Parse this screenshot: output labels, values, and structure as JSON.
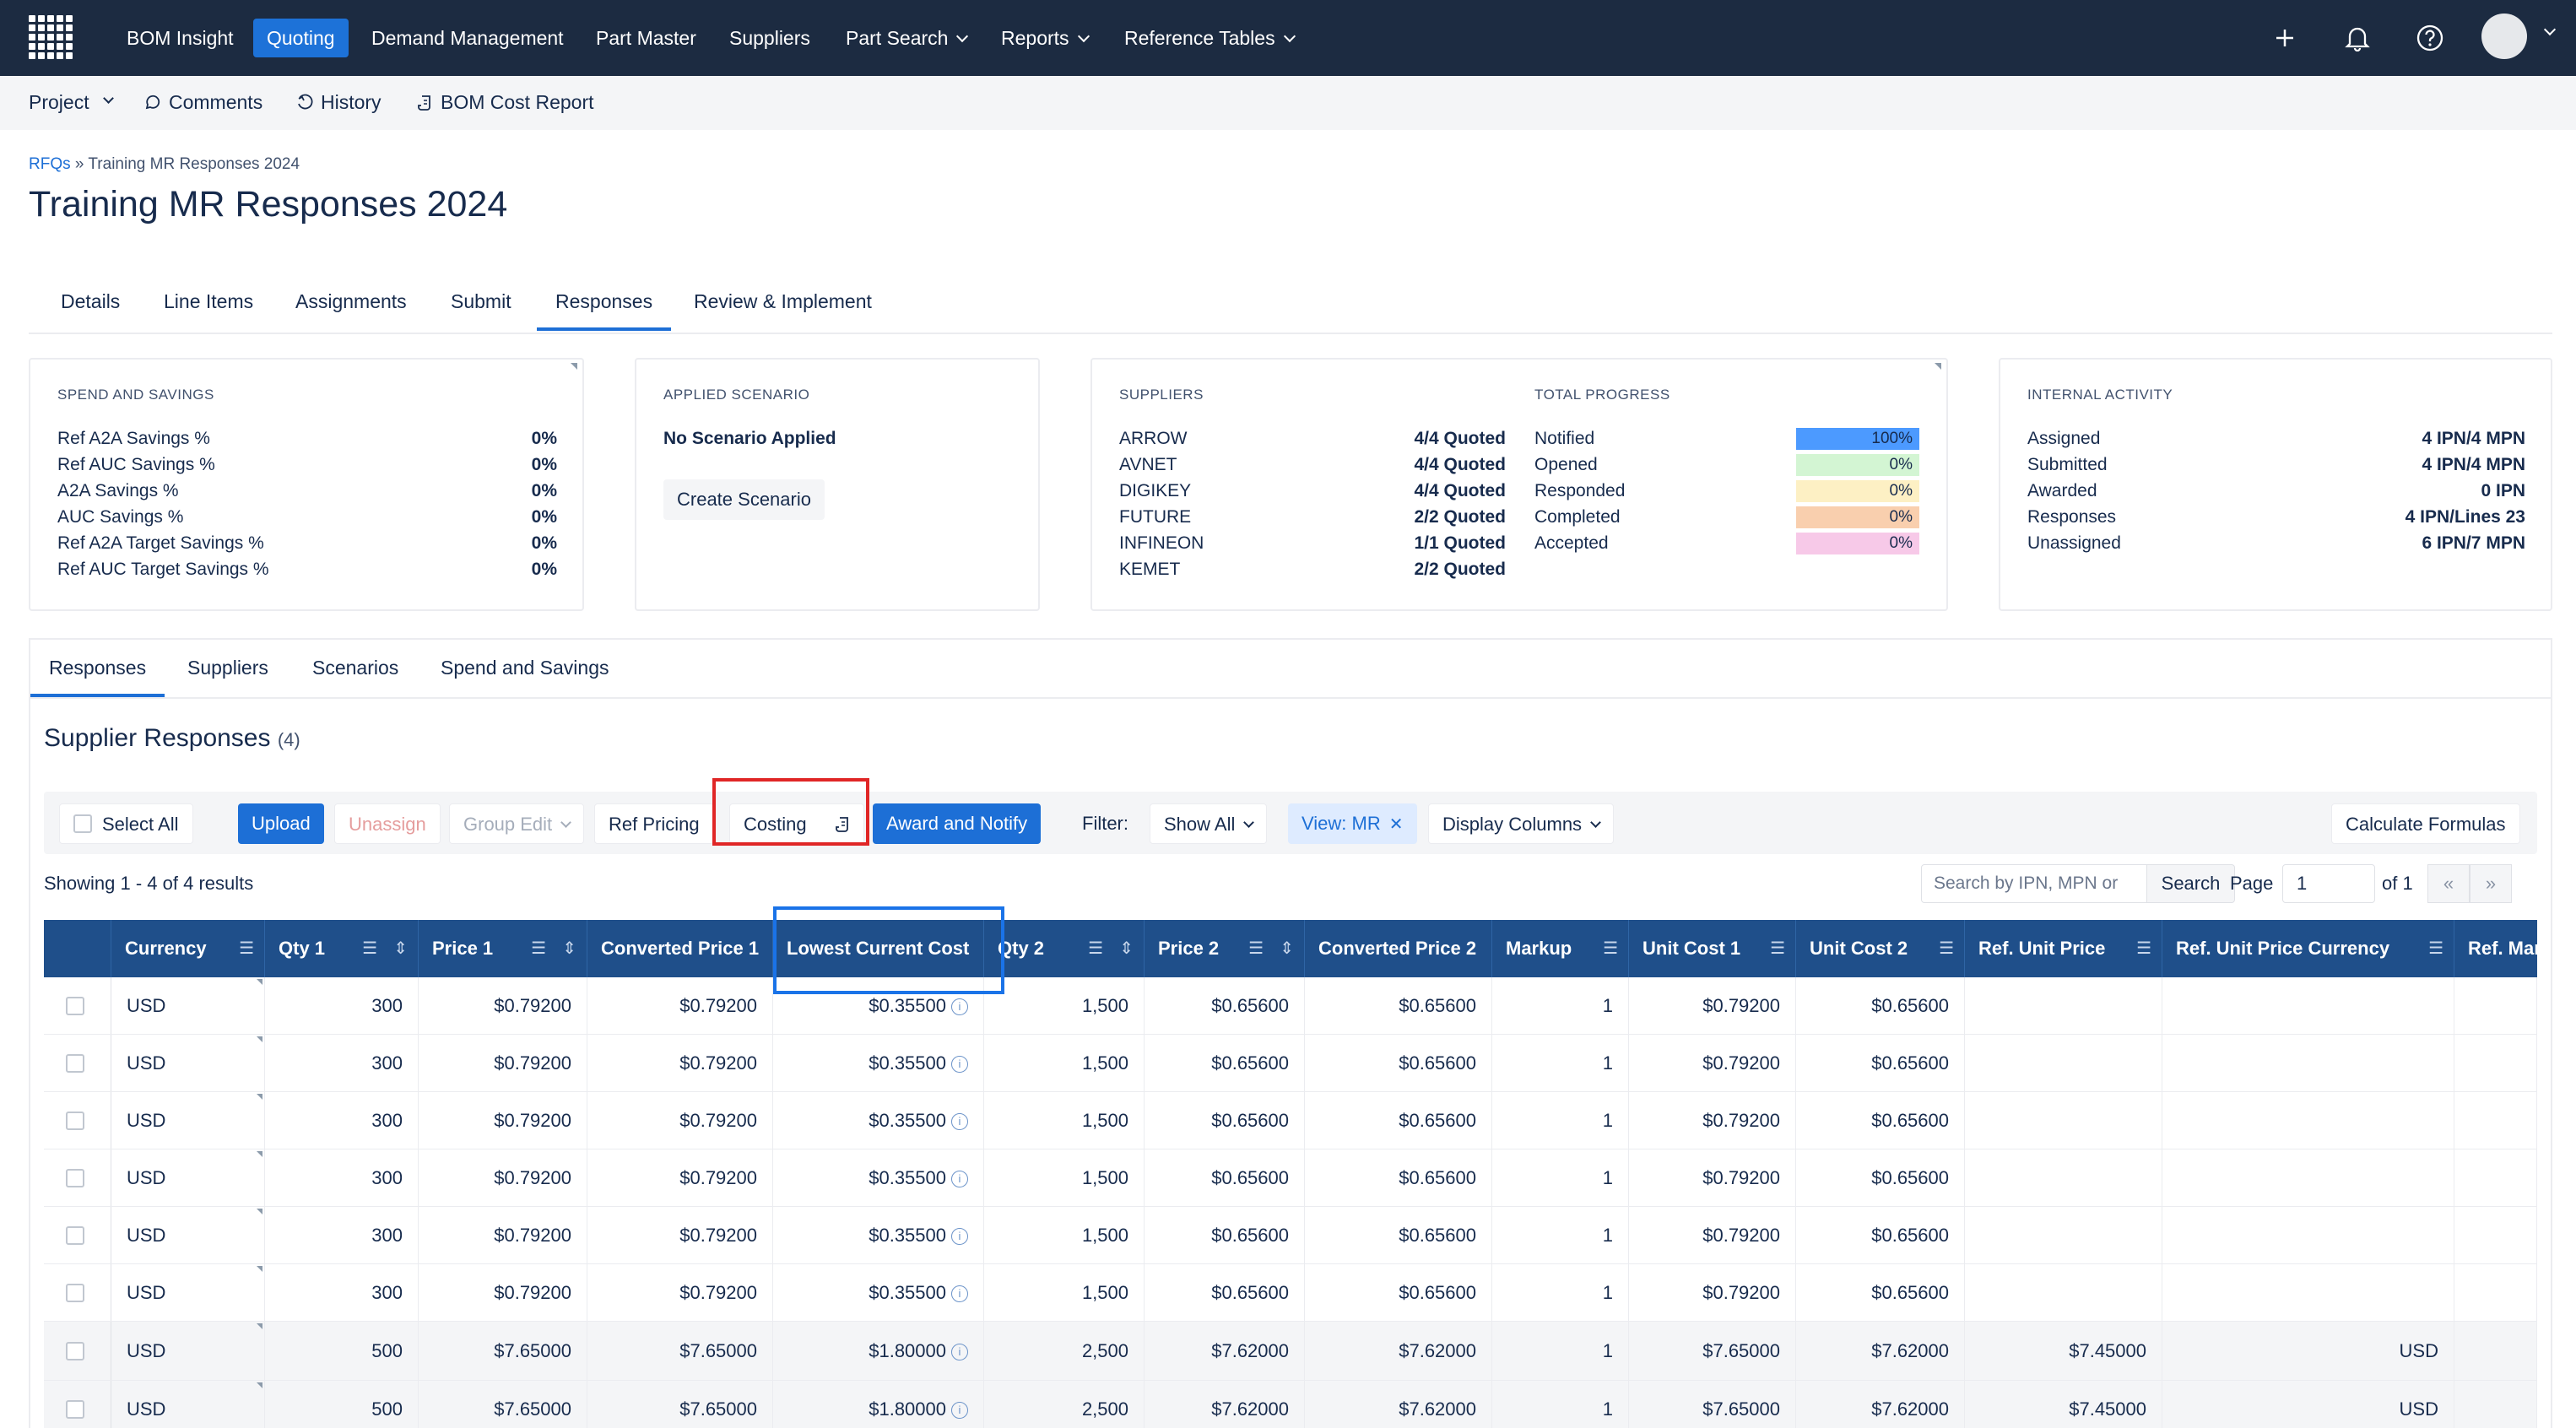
{
  "nav": {
    "items": [
      "BOM Insight",
      "Quoting",
      "Demand Management",
      "Part Master",
      "Suppliers",
      "Part Search",
      "Reports",
      "Reference Tables"
    ]
  },
  "subnav": {
    "project": "Project",
    "comments": "Comments",
    "history": "History",
    "bom_cost_report": "BOM Cost Report"
  },
  "breadcrumb": {
    "link": "RFQs",
    "sep": "»",
    "current": "Training MR Responses 2024"
  },
  "page_title": "Training MR Responses 2024",
  "tabs": [
    "Details",
    "Line Items",
    "Assignments",
    "Submit",
    "Responses",
    "Review & Implement"
  ],
  "spend": {
    "title": "SPEND AND SAVINGS",
    "rows": [
      {
        "label": "Ref A2A Savings %",
        "value": "0%"
      },
      {
        "label": "Ref AUC Savings %",
        "value": "0%"
      },
      {
        "label": "A2A Savings %",
        "value": "0%"
      },
      {
        "label": "AUC Savings %",
        "value": "0%"
      },
      {
        "label": "Ref A2A Target Savings %",
        "value": "0%"
      },
      {
        "label": "Ref AUC Target Savings %",
        "value": "0%"
      }
    ]
  },
  "scenario": {
    "title": "APPLIED SCENARIO",
    "status": "No Scenario Applied",
    "button": "Create Scenario"
  },
  "suppliers": {
    "title": "SUPPLIERS",
    "rows": [
      {
        "name": "ARROW",
        "value": "4/4 Quoted"
      },
      {
        "name": "AVNET",
        "value": "4/4 Quoted"
      },
      {
        "name": "DIGIKEY",
        "value": "4/4 Quoted"
      },
      {
        "name": "FUTURE",
        "value": "2/2 Quoted"
      },
      {
        "name": "INFINEON",
        "value": "1/1 Quoted"
      },
      {
        "name": "KEMET",
        "value": "2/2 Quoted"
      }
    ]
  },
  "progress": {
    "title": "TOTAL PROGRESS",
    "rows": [
      {
        "label": "Notified",
        "value": "100%",
        "fraction": 1.0,
        "color": "#4c9aff"
      },
      {
        "label": "Opened",
        "value": "0%",
        "fraction": 0,
        "color": "#d3f5d3"
      },
      {
        "label": "Responded",
        "value": "0%",
        "fraction": 0,
        "color": "#fdf0c4"
      },
      {
        "label": "Completed",
        "value": "0%",
        "fraction": 0,
        "color": "#f9cfae"
      },
      {
        "label": "Accepted",
        "value": "0%",
        "fraction": 0,
        "color": "#f7c9e8"
      }
    ]
  },
  "internal": {
    "title": "INTERNAL ACTIVITY",
    "rows": [
      {
        "label": "Assigned",
        "value": "4 IPN/4 MPN"
      },
      {
        "label": "Submitted",
        "value": "4 IPN/4 MPN"
      },
      {
        "label": "Awarded",
        "value": "0 IPN"
      },
      {
        "label": "Responses",
        "value": "4 IPN/Lines 23"
      },
      {
        "label": "Unassigned",
        "value": "6 IPN/7 MPN"
      }
    ]
  },
  "subtabs": [
    "Responses",
    "Suppliers",
    "Scenarios",
    "Spend and Savings"
  ],
  "section": {
    "title": "Supplier Responses",
    "count": "(4)"
  },
  "toolbar": {
    "select_all": "Select All",
    "upload": "Upload",
    "unassign": "Unassign",
    "group_edit": "Group Edit",
    "ref_pricing": "Ref Pricing",
    "costing": "Costing",
    "award_notify": "Award and Notify",
    "filter_label": "Filter:",
    "filter_value": "Show All",
    "view_chip": "View: MR",
    "display_columns": "Display Columns",
    "calculate_formulas": "Calculate Formulas"
  },
  "results": {
    "showing": "Showing 1 - 4 of 4 results",
    "search_placeholder": "Search by IPN, MPN or",
    "search_button": "Search",
    "page_label": "Page",
    "page_value": "1",
    "of": "of 1",
    "first": "«",
    "last": "»"
  },
  "grid": {
    "columns": [
      "Currency",
      "Qty 1",
      "Price 1",
      "Converted Price 1",
      "Lowest Current Cost",
      "Qty 2",
      "Price 2",
      "Converted Price 2",
      "Markup",
      "Unit Cost 1",
      "Unit Cost 2",
      "Ref. Unit Price",
      "Ref. Unit Price Currency",
      "Ref. Mark U"
    ],
    "rows": [
      [
        "USD",
        "300",
        "$0.79200",
        "$0.79200",
        "$0.35500",
        "1,500",
        "$0.65600",
        "$0.65600",
        "1",
        "$0.79200",
        "$0.65600",
        "",
        "",
        ""
      ],
      [
        "USD",
        "300",
        "$0.79200",
        "$0.79200",
        "$0.35500",
        "1,500",
        "$0.65600",
        "$0.65600",
        "1",
        "$0.79200",
        "$0.65600",
        "",
        "",
        ""
      ],
      [
        "USD",
        "300",
        "$0.79200",
        "$0.79200",
        "$0.35500",
        "1,500",
        "$0.65600",
        "$0.65600",
        "1",
        "$0.79200",
        "$0.65600",
        "",
        "",
        ""
      ],
      [
        "USD",
        "300",
        "$0.79200",
        "$0.79200",
        "$0.35500",
        "1,500",
        "$0.65600",
        "$0.65600",
        "1",
        "$0.79200",
        "$0.65600",
        "",
        "",
        ""
      ],
      [
        "USD",
        "300",
        "$0.79200",
        "$0.79200",
        "$0.35500",
        "1,500",
        "$0.65600",
        "$0.65600",
        "1",
        "$0.79200",
        "$0.65600",
        "",
        "",
        ""
      ],
      [
        "USD",
        "300",
        "$0.79200",
        "$0.79200",
        "$0.35500",
        "1,500",
        "$0.65600",
        "$0.65600",
        "1",
        "$0.79200",
        "$0.65600",
        "",
        "",
        ""
      ],
      [
        "USD",
        "500",
        "$7.65000",
        "$7.65000",
        "$1.80000",
        "2,500",
        "$7.62000",
        "$7.62000",
        "1",
        "$7.65000",
        "$7.62000",
        "$7.45000",
        "USD",
        ""
      ],
      [
        "USD",
        "500",
        "$7.65000",
        "$7.65000",
        "$1.80000",
        "2,500",
        "$7.62000",
        "$7.62000",
        "1",
        "$7.65000",
        "$7.62000",
        "$7.45000",
        "USD",
        ""
      ]
    ]
  },
  "colors": {
    "nav_bg": "#1c2b41",
    "accent": "#1d6fd6",
    "grid_header": "#1f4f8a",
    "highlight_red": "#e02626",
    "highlight_blue": "#1a73e8"
  },
  "icons": [
    "app-grid-icon",
    "plus-icon",
    "bell-icon",
    "help-icon",
    "comment-icon",
    "history-icon",
    "report-icon",
    "sort-icon",
    "filter-icon",
    "info-icon"
  ]
}
